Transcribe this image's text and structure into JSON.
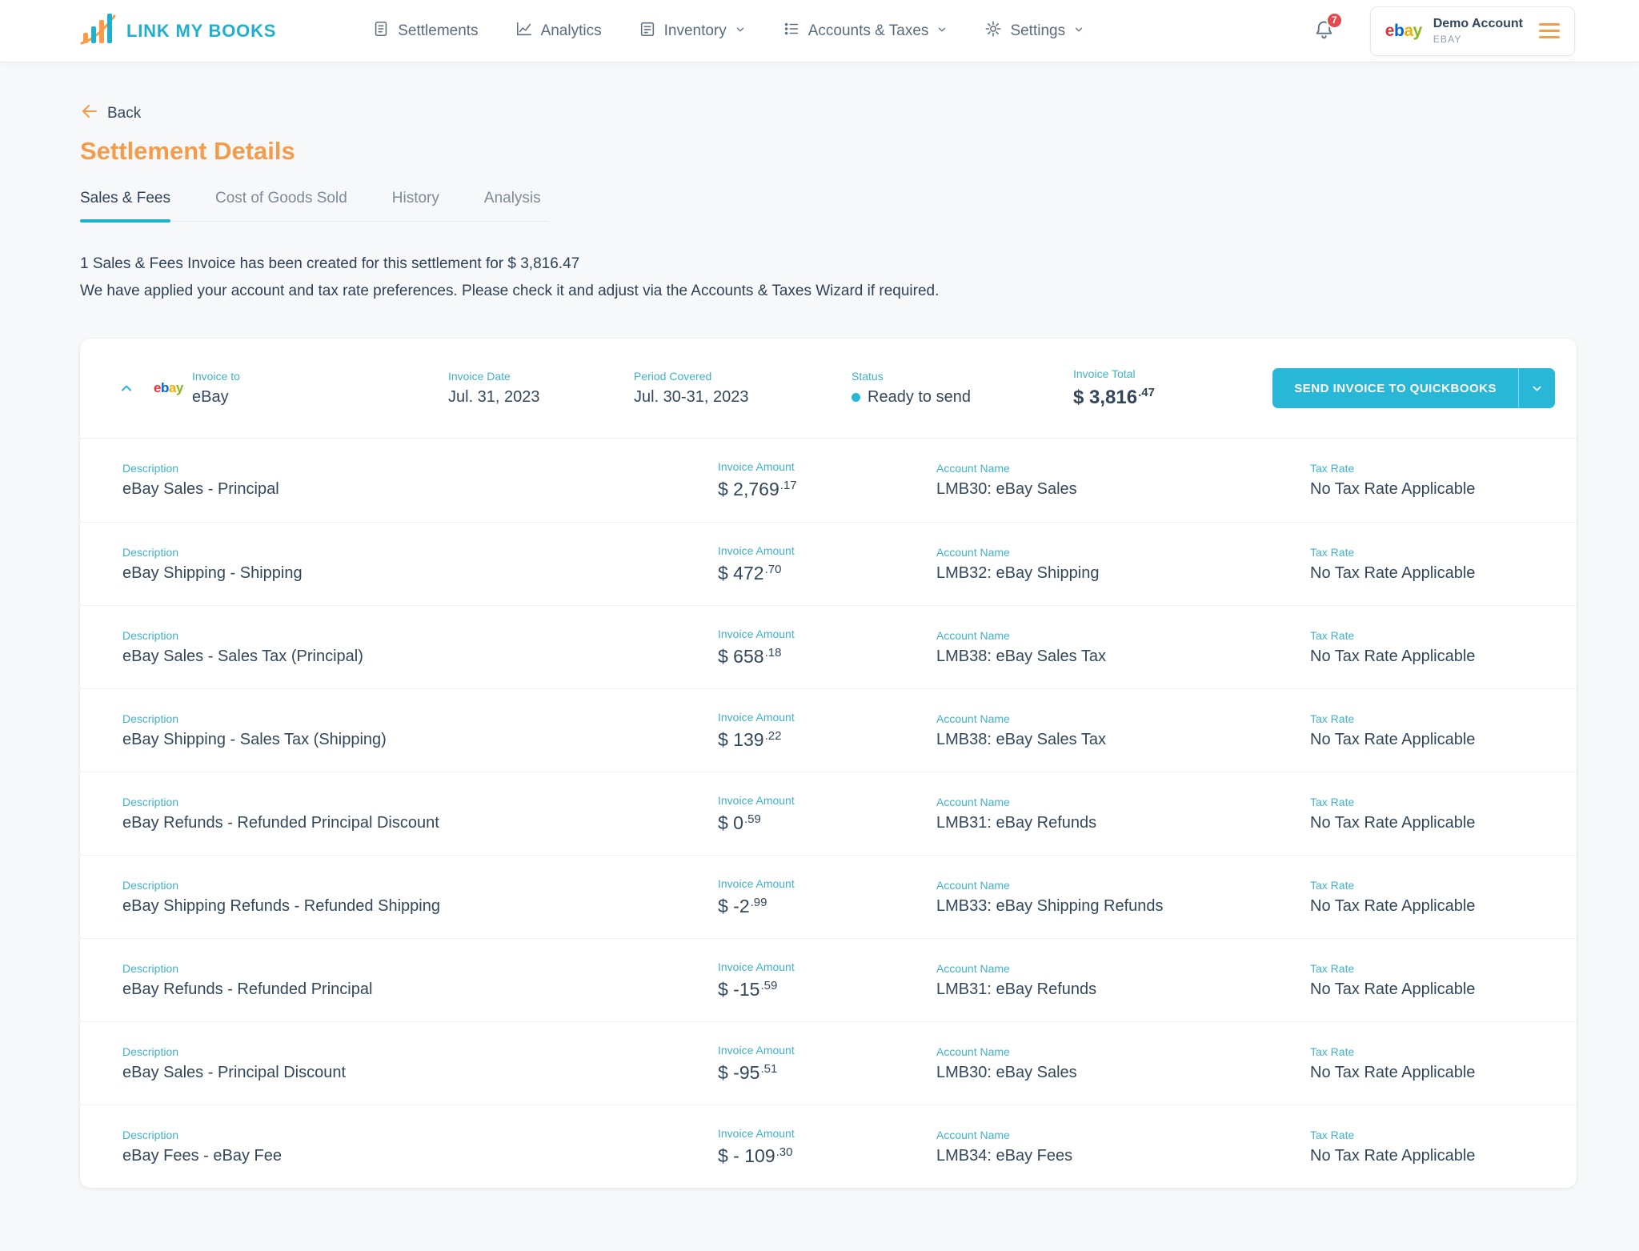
{
  "colors": {
    "accent_cyan": "#29b7d8",
    "brand_orange": "#f79b4b",
    "navy_text": "#33475b",
    "label_teal": "#3fb3c9",
    "badge_red": "#e5484d"
  },
  "brand": {
    "name": "LINK MY BOOKS"
  },
  "ebay_logo": {
    "letters": [
      "e",
      "b",
      "a",
      "y"
    ],
    "colors": [
      "#e53238",
      "#0064d2",
      "#f5af02",
      "#86b817"
    ]
  },
  "nav": {
    "items": [
      {
        "label": "Settlements",
        "has_chevron": false
      },
      {
        "label": "Analytics",
        "has_chevron": false
      },
      {
        "label": "Inventory",
        "has_chevron": true
      },
      {
        "label": "Accounts & Taxes",
        "has_chevron": true
      },
      {
        "label": "Settings",
        "has_chevron": true
      }
    ],
    "notification_count": "7",
    "account": {
      "name": "Demo Account",
      "channel": "EBAY"
    }
  },
  "page": {
    "back_label": "Back",
    "title": "Settlement Details",
    "tabs": [
      {
        "label": "Sales & Fees",
        "active": true
      },
      {
        "label": "Cost of Goods Sold",
        "active": false
      },
      {
        "label": "History",
        "active": false
      },
      {
        "label": "Analysis",
        "active": false
      }
    ],
    "summary_line1": "1 Sales & Fees Invoice has been created for this settlement for $ 3,816.47",
    "summary_line2": "We have applied your account and tax rate preferences. Please check it and adjust via the Accounts & Taxes Wizard if required."
  },
  "invoice": {
    "header": {
      "invoice_to_label": "Invoice to",
      "invoice_to": "eBay",
      "invoice_date_label": "Invoice Date",
      "invoice_date": "Jul. 31, 2023",
      "period_label": "Period Covered",
      "period": "Jul. 30-31, 2023",
      "status_label": "Status",
      "status": "Ready to send",
      "total_label": "Invoice Total",
      "total_main": "$ 3,816",
      "total_decimal": ".47",
      "send_button": "SEND INVOICE TO QUICKBOOKS"
    },
    "row_labels": {
      "description": "Description",
      "amount": "Invoice Amount",
      "account": "Account Name",
      "tax": "Tax Rate"
    },
    "rows": [
      {
        "description": "eBay Sales - Principal",
        "amount_main": "$ 2,769",
        "amount_decimal": ".17",
        "account": "LMB30: eBay Sales",
        "tax": "No Tax Rate Applicable"
      },
      {
        "description": "eBay Shipping - Shipping",
        "amount_main": "$ 472",
        "amount_decimal": ".70",
        "account": "LMB32: eBay Shipping",
        "tax": "No Tax Rate Applicable"
      },
      {
        "description": "eBay Sales - Sales Tax (Principal)",
        "amount_main": "$ 658",
        "amount_decimal": ".18",
        "account": "LMB38: eBay Sales Tax",
        "tax": "No Tax Rate Applicable"
      },
      {
        "description": "eBay Shipping - Sales Tax (Shipping)",
        "amount_main": "$ 139",
        "amount_decimal": ".22",
        "account": "LMB38: eBay Sales Tax",
        "tax": "No Tax Rate Applicable"
      },
      {
        "description": "eBay Refunds - Refunded Principal Discount",
        "amount_main": "$ 0",
        "amount_decimal": ".59",
        "account": "LMB31: eBay Refunds",
        "tax": "No Tax Rate Applicable"
      },
      {
        "description": "eBay Shipping Refunds - Refunded Shipping",
        "amount_main": "$ -2",
        "amount_decimal": ".99",
        "account": "LMB33: eBay Shipping Refunds",
        "tax": "No Tax Rate Applicable"
      },
      {
        "description": "eBay Refunds - Refunded Principal",
        "amount_main": "$ -15",
        "amount_decimal": ".59",
        "account": "LMB31: eBay Refunds",
        "tax": "No Tax Rate Applicable"
      },
      {
        "description": "eBay Sales - Principal Discount",
        "amount_main": "$ -95",
        "amount_decimal": ".51",
        "account": "LMB30: eBay Sales",
        "tax": "No Tax Rate Applicable"
      },
      {
        "description": "eBay Fees - eBay Fee",
        "amount_main": "$ - 109",
        "amount_decimal": ".30",
        "account": "LMB34: eBay Fees",
        "tax": "No Tax Rate Applicable"
      }
    ]
  }
}
